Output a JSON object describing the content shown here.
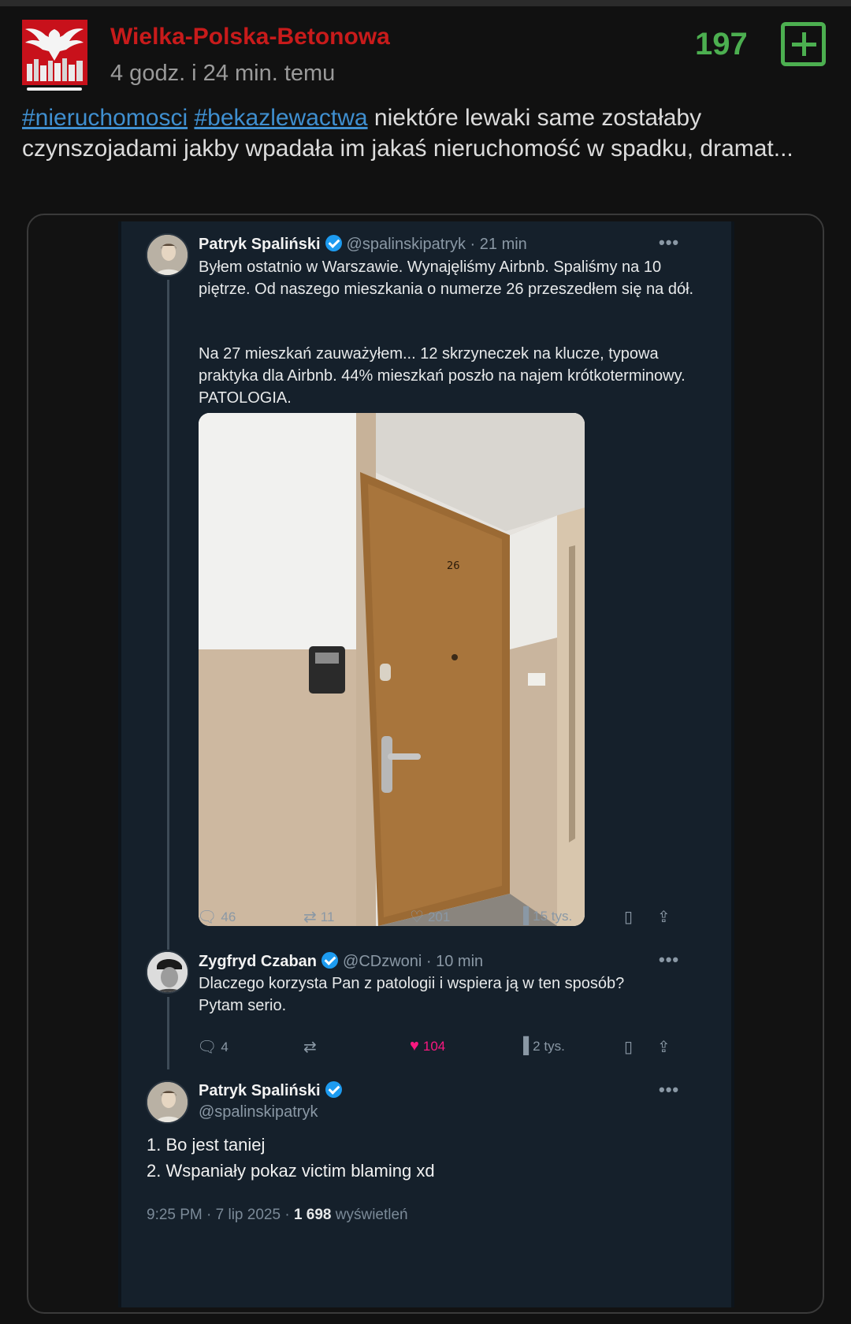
{
  "post": {
    "author": "Wielka-Polska-Betonowa",
    "time": "4 godz. i 24 min. temu",
    "score": "197",
    "tags": [
      "#nieruchomosci",
      "#bekazlewactwa"
    ],
    "text": "niektóre lewaki same zostałaby czynszojadami jakby wpadała im jakaś nieruchomość w spadku, dramat..."
  },
  "tweet1": {
    "name": "Patryk Spaliński",
    "handle_time": "@spalinskipatryk · 21 min",
    "para1": "Byłem ostatnio w Warszawie. Wynajęliśmy Airbnb. Spaliśmy na 10 piętrze. Od naszego mieszkania o numerze 26 przeszedłem się na dół.",
    "para2": "Na 27 mieszkań zauważyłem... 12 skrzyneczek na klucze, typowa praktyka dla Airbnb. 44% mieszkań poszło na najem krótkoterminowy. PATOLOGIA.",
    "door_number": "26",
    "replies": "46",
    "retweets": "11",
    "likes": "201",
    "views": "15 tys."
  },
  "tweet2": {
    "name": "Zygfryd Czaban",
    "handle_time": "@CDzwoni · 10 min",
    "text": "Dlaczego korzysta Pan z patologii i wspiera ją w ten sposób? Pytam serio.",
    "replies": "4",
    "likes": "104",
    "views": "2 tys."
  },
  "tweet3": {
    "name": "Patryk Spaliński",
    "handle": "@spalinskipatryk",
    "line1": "1. Bo jest taniej",
    "line2": "2. Wspaniały pokaz victim blaming xd",
    "footer_time": "9:25 PM · 7 lip 2025 · ",
    "footer_views": "1 698",
    "footer_views_label": " wyświetleń"
  },
  "icons": {
    "more": "•••",
    "reply": "reply-icon",
    "retweet": "retweet-icon",
    "like": "heart-icon",
    "views": "views-icon",
    "bookmark": "bookmark-icon",
    "share": "share-icon"
  },
  "colors": {
    "author": "#c81b1b",
    "score": "#4caf50",
    "tag": "#3f8fd0",
    "verified": "#1d9bf0",
    "liked": "#f91880"
  }
}
